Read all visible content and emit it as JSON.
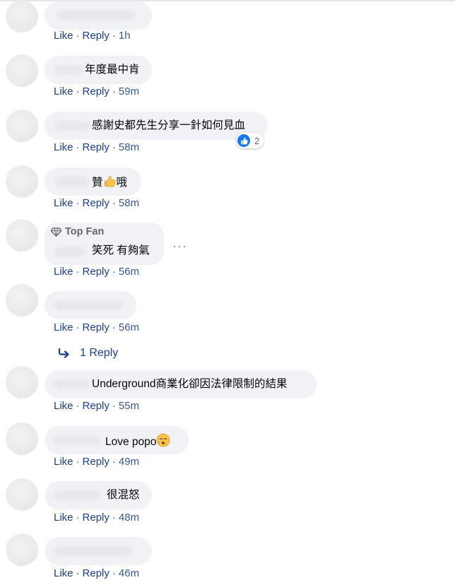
{
  "actions": {
    "like": "Like",
    "reply": "Reply",
    "separator": "·"
  },
  "comments": [
    {
      "text": "",
      "time": "1h"
    },
    {
      "text": "年度最中肯",
      "time": "59m"
    },
    {
      "text": "感謝史都先生分享一針如何見血",
      "time": "58m",
      "reaction_count": "2"
    },
    {
      "text": "贊",
      "text_after": "哦",
      "time": "58m"
    },
    {
      "badge": "Top Fan",
      "text": "笑死 有夠氣",
      "time": "56m"
    },
    {
      "text": "",
      "time": "56m",
      "replies_link": "1 Reply"
    },
    {
      "text": "Underground商業化卻因法律限制的結果",
      "time": "55m"
    },
    {
      "text": "Love popo",
      "time": "49m"
    },
    {
      "text": "很混怒",
      "time": "48m"
    },
    {
      "text": "",
      "time": "46m"
    }
  ],
  "colors": {
    "bubble": "#f0f2f5",
    "link": "#385898",
    "like_blue": "#1877f2"
  },
  "icons": [
    "like-reaction-icon",
    "thumbs-up-emoji",
    "diamond-icon",
    "more-options-icon",
    "reply-arrow-icon",
    "crying-face-emoji"
  ]
}
